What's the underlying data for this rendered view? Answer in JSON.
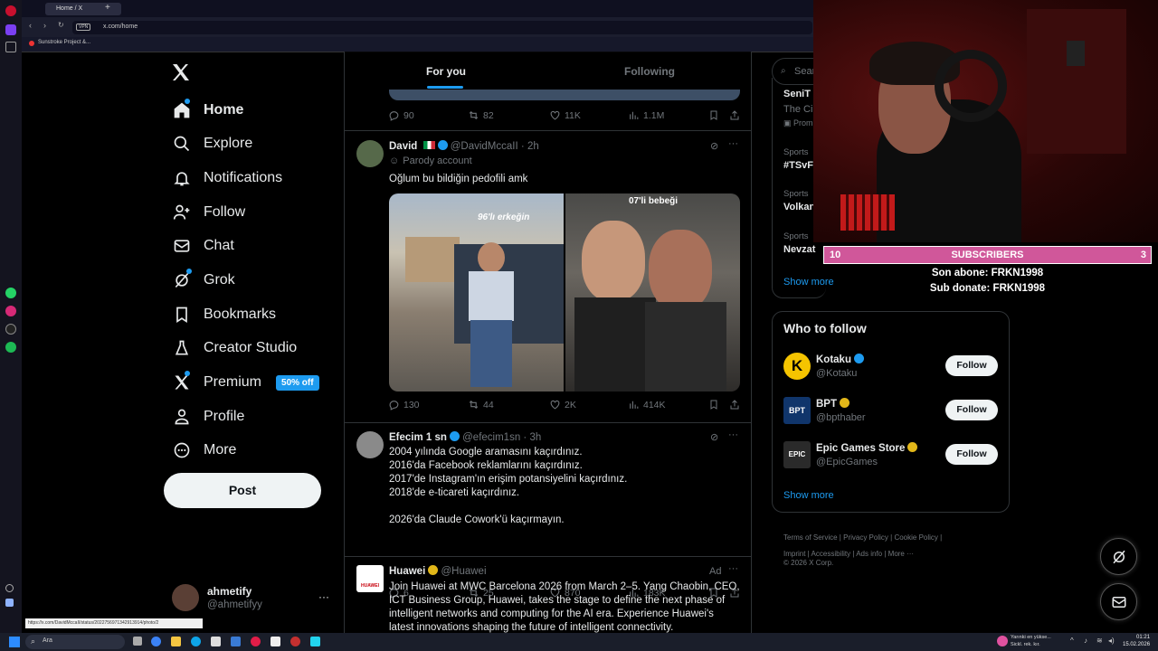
{
  "browser": {
    "tab_title": "Home / X",
    "url": "x.com/home",
    "vpn_label": "VPN",
    "bookmark": "Sunstroke Project &...",
    "status_url": "https://x.com/DavidMccaII/status/2022756971342913914/photo/2"
  },
  "nav": {
    "items": [
      {
        "label": "Home",
        "icon": "home-icon"
      },
      {
        "label": "Explore",
        "icon": "search-icon"
      },
      {
        "label": "Notifications",
        "icon": "bell-icon"
      },
      {
        "label": "Follow",
        "icon": "person-add-icon"
      },
      {
        "label": "Chat",
        "icon": "mail-icon"
      },
      {
        "label": "Grok",
        "icon": "grok-icon"
      },
      {
        "label": "Bookmarks",
        "icon": "bookmark-icon"
      },
      {
        "label": "Creator Studio",
        "icon": "creator-icon"
      },
      {
        "label": "Premium",
        "icon": "x-logo-icon"
      },
      {
        "label": "Profile",
        "icon": "person-icon"
      },
      {
        "label": "More",
        "icon": "more-circle-icon"
      }
    ],
    "premium_badge": "50% off",
    "post_label": "Post",
    "account_name": "ahmetify",
    "account_handle": "@ahmetifyy"
  },
  "feed": {
    "tabs": [
      "For you",
      "Following"
    ],
    "first_actions": {
      "replies": "90",
      "reposts": "82",
      "likes": "11K",
      "views": "1.1M"
    },
    "tweets": [
      {
        "name": "David",
        "handle": "@DavidMccaII",
        "time": "2h",
        "sub": "Parody account",
        "text": "Oğlum bu bildiğin pedofili amk",
        "img1_text": "96'lı erkeğin",
        "img2_text": "07'li bebeği",
        "replies": "130",
        "reposts": "44",
        "likes": "2K",
        "views": "414K"
      },
      {
        "name": "Efecim 1 sn",
        "handle": "@efecim1sn",
        "time": "3h",
        "lines": [
          "2004 yılında Google aramasını kaçırdınız.",
          "2016'da Facebook reklamlarını kaçırdınız.",
          "2017'de Instagram'ın erişim potansiyelini kaçırdınız.",
          "2018'de e-ticareti kaçırdınız.",
          "",
          "2026'da Claude Cowork'ü kaçırmayın."
        ],
        "replies": "6",
        "reposts": "25",
        "likes": "870",
        "views": "183K"
      },
      {
        "name": "Huawei",
        "handle": "@Huawei",
        "ad": "Ad",
        "logo_text": "HUAWEI",
        "lines": [
          "Join Huawei at MWC Barcelona 2026 from March 2–5. Yang Chaobin, CEO,",
          "ICT Business Group, Huawei, takes the stage to define the next phase of",
          "intelligent networks and computing for the AI era. Experience Huawei's",
          "latest innovations shaping the future of intelligent connectivity."
        ]
      }
    ]
  },
  "right": {
    "search_placeholder": "Sear",
    "trends": [
      {
        "cat": "",
        "title": "SeniT",
        "sub": "The Ci",
        "promo": "Prom"
      },
      {
        "cat": "Sports",
        "title": "#TSvF"
      },
      {
        "cat": "Sports",
        "title": "Volkan"
      },
      {
        "cat": "Sports",
        "title": "Nevzat"
      }
    ],
    "show_more": "Show more",
    "who_to_follow_title": "Who to follow",
    "suggestions": [
      {
        "name": "Kotaku",
        "handle": "@Kotaku",
        "badge": "blue"
      },
      {
        "name": "BPT",
        "handle": "@bpthaber",
        "badge": "gold"
      },
      {
        "name": "Epic Games Store",
        "handle": "@EpicGames",
        "badge": "gold"
      }
    ],
    "follow_label": "Follow",
    "show_more_2": "Show more",
    "footer": [
      "Terms of Service",
      "Privacy Policy",
      "Cookie Policy",
      "Imprint",
      "Accessibility",
      "Ads info",
      "More ···"
    ],
    "copyright": "© 2026 X Corp."
  },
  "stream": {
    "sub_count_left": "10",
    "sub_label": "SUBSCRIBERS",
    "sub_count_right": "3",
    "last_sub": "Son abone: FRKN1998",
    "last_donate": "Sub donate: FRKN1998"
  },
  "taskbar": {
    "search": "Ara",
    "notif_line1": "Yarınki en yükse...",
    "notif_line2": "Sickl. rek. kır.",
    "time": "01:21",
    "date": "15.02.2026"
  },
  "colors": {
    "accent": "#1d9bf0",
    "sub_bar": "#d0579a"
  }
}
